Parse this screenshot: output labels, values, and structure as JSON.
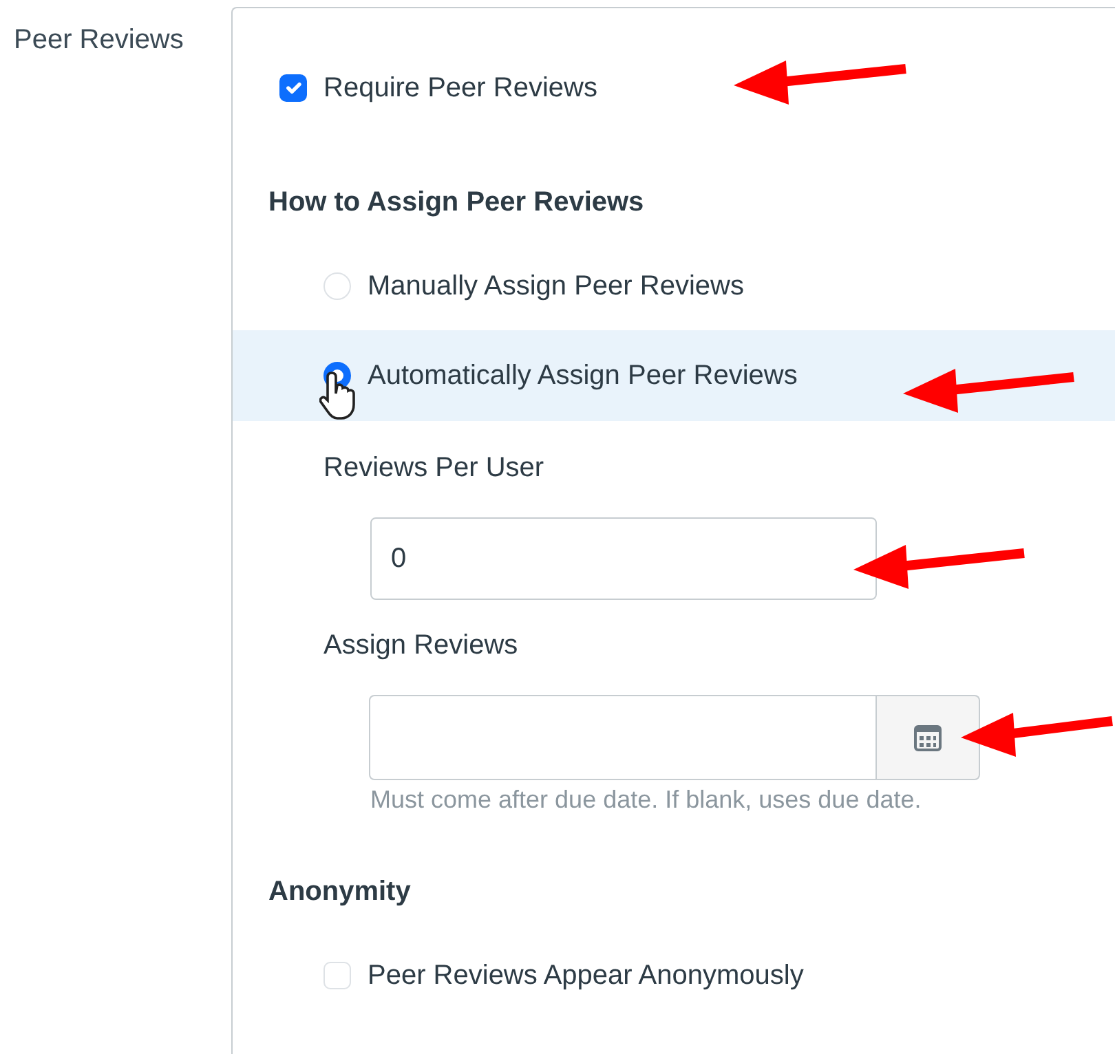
{
  "section_label": "Peer Reviews",
  "require": {
    "label": "Require Peer Reviews",
    "checked": true
  },
  "assign_heading": "How to Assign Peer Reviews",
  "assign_options": [
    {
      "label": "Manually Assign Peer Reviews",
      "selected": false
    },
    {
      "label": "Automatically Assign Peer Reviews",
      "selected": true
    }
  ],
  "reviews_per_user": {
    "label": "Reviews Per User",
    "value": "0"
  },
  "assign_reviews": {
    "label": "Assign Reviews",
    "help": "Must come after due date. If blank, uses due date."
  },
  "anonymity_heading": "Anonymity",
  "anonymous": {
    "label": "Peer Reviews Appear Anonymously",
    "checked": false
  }
}
